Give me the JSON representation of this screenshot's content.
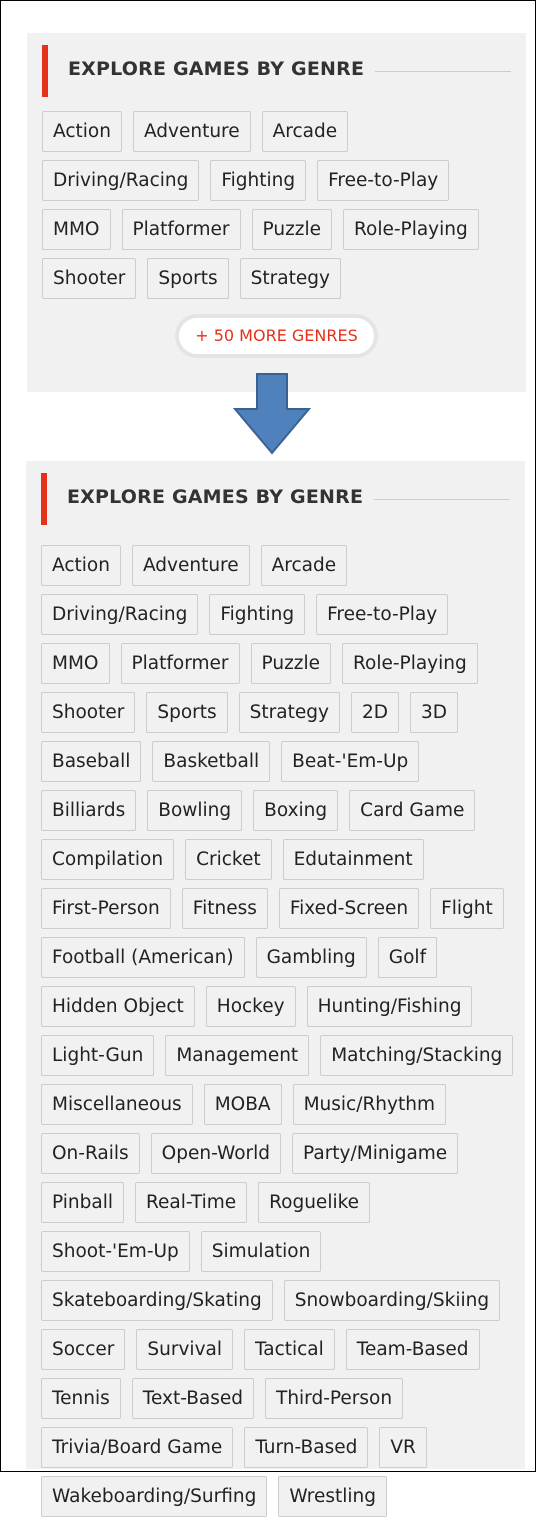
{
  "title": "EXPLORE GAMES BY GENRE",
  "more_button": "+ 50 MORE GENRES",
  "colors": {
    "accent": "#e5301a",
    "arrow": "#4f81bd",
    "panel_bg": "#f1f1f1"
  },
  "collapsed_genres": [
    "Action",
    "Adventure",
    "Arcade",
    "Driving/Racing",
    "Fighting",
    "Free-to-Play",
    "MMO",
    "Platformer",
    "Puzzle",
    "Role-Playing",
    "Shooter",
    "Sports",
    "Strategy"
  ],
  "expanded_genres": [
    "Action",
    "Adventure",
    "Arcade",
    "Driving/Racing",
    "Fighting",
    "Free-to-Play",
    "MMO",
    "Platformer",
    "Puzzle",
    "Role-Playing",
    "Shooter",
    "Sports",
    "Strategy",
    "2D",
    "3D",
    "Baseball",
    "Basketball",
    "Beat-'Em-Up",
    "Billiards",
    "Bowling",
    "Boxing",
    "Card Game",
    "Compilation",
    "Cricket",
    "Edutainment",
    "First-Person",
    "Fitness",
    "Fixed-Screen",
    "Flight",
    "Football (American)",
    "Gambling",
    "Golf",
    "Hidden Object",
    "Hockey",
    "Hunting/Fishing",
    "Light-Gun",
    "Management",
    "Matching/Stacking",
    "Miscellaneous",
    "MOBA",
    "Music/Rhythm",
    "On-Rails",
    "Open-World",
    "Party/Minigame",
    "Pinball",
    "Real-Time",
    "Roguelike",
    "Shoot-'Em-Up",
    "Simulation",
    "Skateboarding/Skating",
    "Snowboarding/Skiing",
    "Soccer",
    "Survival",
    "Tactical",
    "Team-Based",
    "Tennis",
    "Text-Based",
    "Third-Person",
    "Trivia/Board Game",
    "Turn-Based",
    "VR",
    "Wakeboarding/Surfing",
    "Wrestling"
  ]
}
